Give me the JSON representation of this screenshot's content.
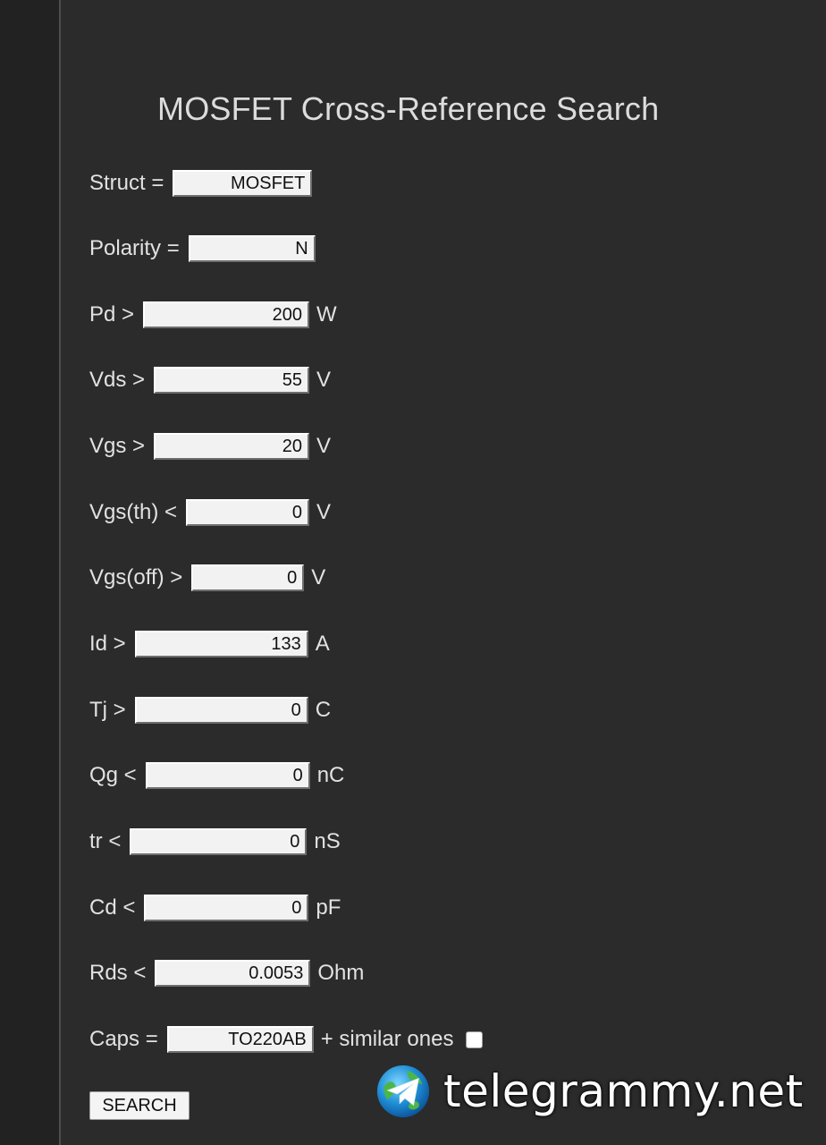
{
  "page": {
    "title": "MOSFET Cross-Reference Search"
  },
  "form": {
    "fields": [
      {
        "label": "Struct =",
        "value": "MOSFET",
        "unit": ""
      },
      {
        "label": "Polarity =",
        "value": "N",
        "unit": ""
      },
      {
        "label": "Pd >",
        "value": "200",
        "unit": "W"
      },
      {
        "label": "Vds >",
        "value": "55",
        "unit": "V"
      },
      {
        "label": "Vgs >",
        "value": "20",
        "unit": "V"
      },
      {
        "label": "Vgs(th) <",
        "value": "0",
        "unit": "V"
      },
      {
        "label": "Vgs(off) >",
        "value": "0",
        "unit": "V"
      },
      {
        "label": "Id >",
        "value": "133",
        "unit": "A"
      },
      {
        "label": "Tj >",
        "value": "0",
        "unit": "C"
      },
      {
        "label": "Qg <",
        "value": "0",
        "unit": "nC"
      },
      {
        "label": "tr <",
        "value": "0",
        "unit": "nS"
      },
      {
        "label": "Cd <",
        "value": "0",
        "unit": "pF"
      },
      {
        "label": "Rds <",
        "value": "0.0053",
        "unit": "Ohm"
      },
      {
        "label": "Caps =",
        "value": "TO220AB",
        "unit": "+ similar ones"
      }
    ],
    "similar_checkbox_checked": false,
    "search_label": "SEARCH"
  },
  "watermark": {
    "text": "telegrammy.net",
    "icon": "telegram-globe-icon"
  },
  "colors": {
    "background": "#2b2b2b",
    "left_strip": "#222222",
    "text": "#e2e2e2",
    "field_bg": "#f2f2f2"
  }
}
